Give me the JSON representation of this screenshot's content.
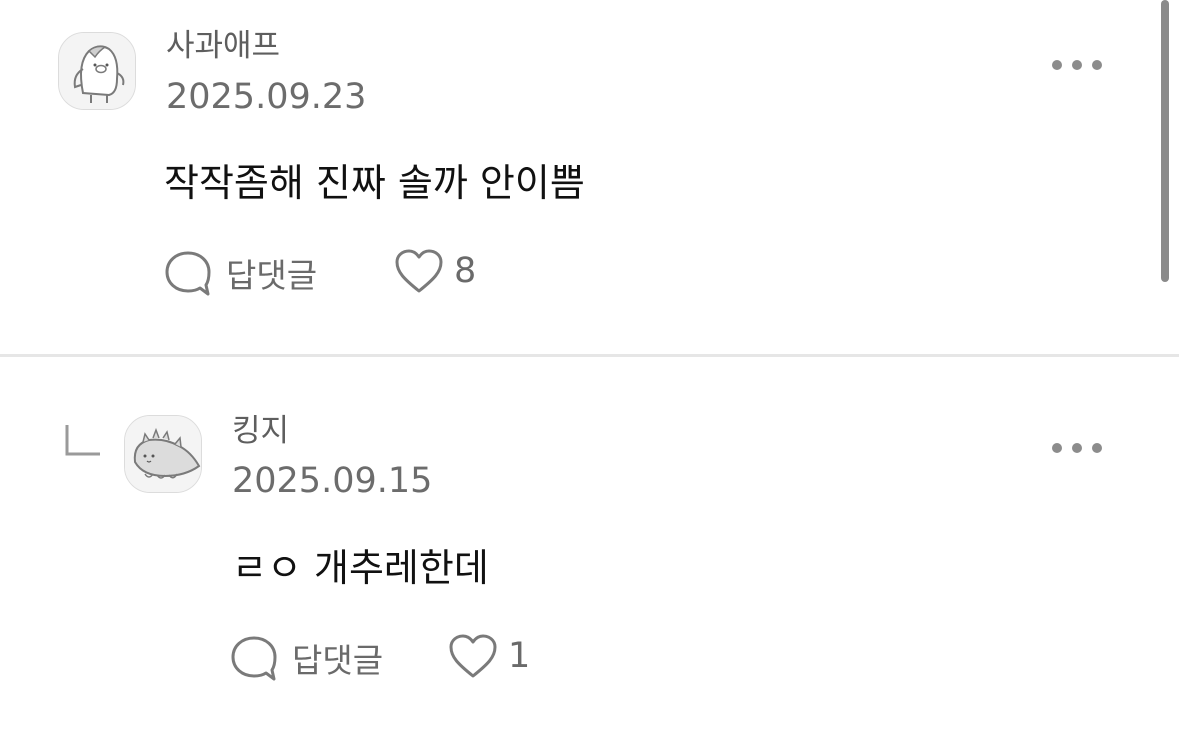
{
  "comments": [
    {
      "author": "사과애프",
      "date": "2025.09.23",
      "text": "작작좀해 진짜 솔까 안이쁨",
      "reply_label": "답댓글",
      "likes": "8",
      "avatar_icon": "pig-character-icon"
    },
    {
      "author": "킹지",
      "date": "2025.09.15",
      "text": "ㄹㅇ 개추레한데",
      "reply_label": "답댓글",
      "likes": "1",
      "avatar_icon": "dinosaur-character-icon",
      "is_reply": true
    }
  ]
}
